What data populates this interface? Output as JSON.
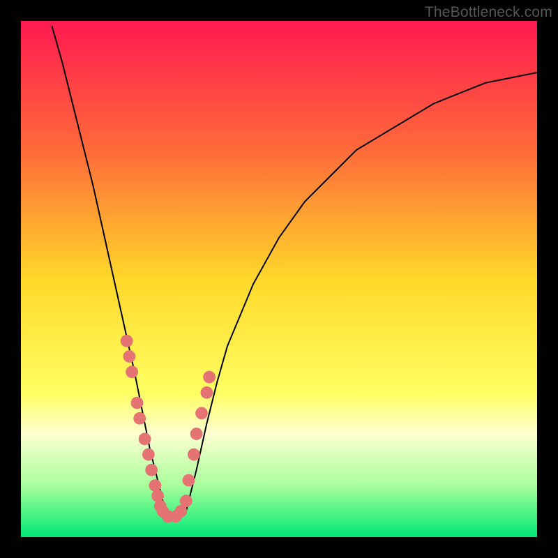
{
  "watermark": "TheBottleneck.com",
  "chart_data": {
    "type": "line",
    "title": "",
    "xlabel": "",
    "ylabel": "",
    "xlim": [
      0,
      100
    ],
    "ylim": [
      0,
      100
    ],
    "gradient_stops": [
      {
        "pct": 0,
        "color": "#ff1a50"
      },
      {
        "pct": 25,
        "color": "#ff6a3a"
      },
      {
        "pct": 50,
        "color": "#ffd82a"
      },
      {
        "pct": 72,
        "color": "#ffff62"
      },
      {
        "pct": 80,
        "color": "#fdffd0"
      },
      {
        "pct": 90,
        "color": "#a8ff9c"
      },
      {
        "pct": 100,
        "color": "#00e874"
      }
    ],
    "series": [
      {
        "name": "curve",
        "color": "#000000",
        "x": [
          6,
          8,
          10,
          12,
          14,
          16,
          18,
          20,
          22,
          24,
          25,
          26,
          27,
          28,
          30,
          32,
          34,
          36,
          38,
          40,
          45,
          50,
          55,
          60,
          65,
          70,
          75,
          80,
          85,
          90,
          95,
          100
        ],
        "y": [
          99,
          92,
          84,
          76,
          68,
          59,
          50,
          41,
          32,
          22,
          17,
          13,
          9,
          5,
          4,
          5,
          13,
          22,
          30,
          37,
          49,
          58,
          65,
          70,
          75,
          78,
          81,
          84,
          86,
          88,
          89,
          90
        ]
      }
    ],
    "points": {
      "name": "dots",
      "color": "#e57373",
      "radius_w": 1.2,
      "x": [
        20.5,
        21.0,
        21.5,
        22.5,
        23.0,
        24.0,
        24.7,
        25.3,
        26.0,
        26.5,
        27.0,
        27.5,
        28.5,
        30.0,
        31.0,
        32.0,
        32.5,
        33.5,
        34.0,
        35.0,
        36.0,
        36.5
      ],
      "y": [
        38,
        35,
        32,
        26,
        23,
        19,
        16,
        13,
        10,
        8,
        6,
        5,
        4,
        4,
        5,
        7,
        11,
        16,
        20,
        24,
        28,
        31
      ]
    }
  }
}
